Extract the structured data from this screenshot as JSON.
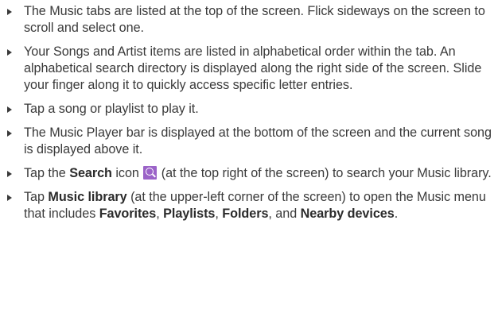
{
  "bullets": [
    {
      "text": "The Music tabs are listed at the top of the screen. Flick sideways on the screen to scroll and select one."
    },
    {
      "text": "Your Songs and Artist items are listed in alphabetical order within the tab. An alphabetical search directory is displayed along the right side of the screen. Slide your finger along it to quickly access specific letter entries."
    },
    {
      "text": "Tap a song or playlist to play it."
    },
    {
      "text": "The Music Player bar is displayed at the bottom of the screen and the current song is displayed above it."
    },
    {
      "prefix": "Tap the ",
      "bold": "Search",
      "middle": " icon ",
      "icon": "search-icon",
      "icon_color": "#9b63c8",
      "suffix": " (at the top right of the screen) to search your Music library."
    },
    {
      "prefix": "Tap ",
      "bold": "Music library",
      "middle": " (at the upper-left corner of the screen) to open the Music menu that includes ",
      "item1": "Favorites",
      "sep1": ", ",
      "item2": "Playlists",
      "sep2": ", ",
      "item3": "Folders",
      "sep3": ", and ",
      "item4": "Nearby devices",
      "end": "."
    }
  ]
}
